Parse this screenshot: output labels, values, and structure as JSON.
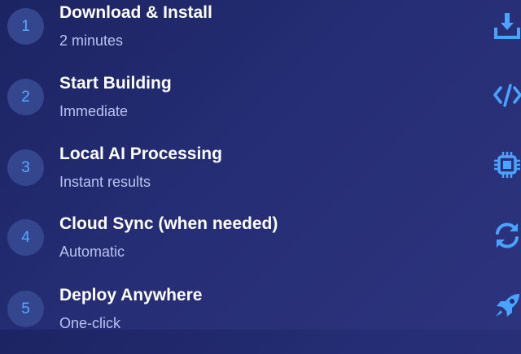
{
  "steps": [
    {
      "number": "1",
      "title": "Download & Install",
      "subtitle": "2 minutes",
      "icon": "download-icon"
    },
    {
      "number": "2",
      "title": "Start Building",
      "subtitle": "Immediate",
      "icon": "code-icon"
    },
    {
      "number": "3",
      "title": "Local AI Processing",
      "subtitle": "Instant results",
      "icon": "chip-icon"
    },
    {
      "number": "4",
      "title": "Cloud Sync (when needed)",
      "subtitle": "Automatic",
      "icon": "sync-icon"
    },
    {
      "number": "5",
      "title": "Deploy Anywhere",
      "subtitle": "One-click",
      "icon": "rocket-icon"
    }
  ],
  "colors": {
    "background_start": "#1c2463",
    "background_end": "#2d347d",
    "circle_fill": "#33468e",
    "number_text": "#57a9ff",
    "title_text": "#ffffff",
    "subtitle_text": "#b9c4ef",
    "icon_accent": "#4aa3ff"
  }
}
